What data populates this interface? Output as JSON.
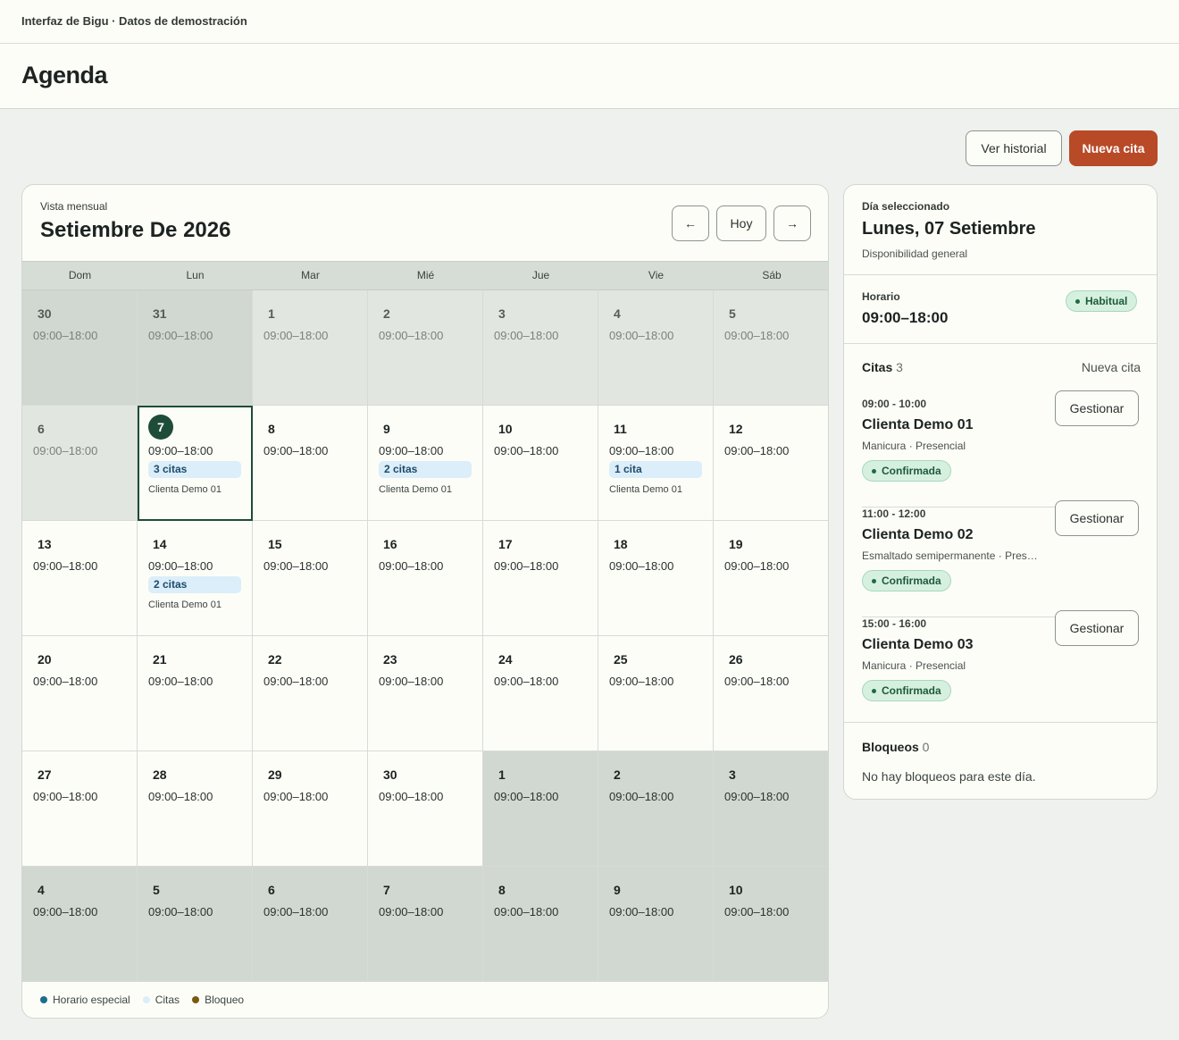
{
  "app": {
    "breadcrumb": "Interfaz de Bigu · Datos de demostración",
    "page_title": "Agenda"
  },
  "toolbar": {
    "history_label": "Ver historial",
    "new_label": "Nueva cita"
  },
  "calendar": {
    "view_label": "Vista mensual",
    "month_title": "Setiembre De 2026",
    "prev_label": "←",
    "today_label": "Hoy",
    "next_label": "→",
    "weekdays": [
      "Dom",
      "Lun",
      "Mar",
      "Mié",
      "Jue",
      "Vie",
      "Sáb"
    ],
    "weeks": [
      [
        {
          "day": "30",
          "hours": "09:00–18:00",
          "shade": "dark"
        },
        {
          "day": "31",
          "hours": "09:00–18:00",
          "shade": "dark"
        },
        {
          "day": "1",
          "hours": "09:00–18:00",
          "shade": "grey"
        },
        {
          "day": "2",
          "hours": "09:00–18:00",
          "shade": "grey"
        },
        {
          "day": "3",
          "hours": "09:00–18:00",
          "shade": "grey"
        },
        {
          "day": "4",
          "hours": "09:00–18:00",
          "shade": "grey"
        },
        {
          "day": "5",
          "hours": "09:00–18:00",
          "shade": "grey"
        }
      ],
      [
        {
          "day": "6",
          "hours": "09:00–18:00",
          "shade": "grey"
        },
        {
          "day": "7",
          "hours": "09:00–18:00",
          "selected": true,
          "badge": "3 citas",
          "client": "Clienta Demo 01"
        },
        {
          "day": "8",
          "hours": "09:00–18:00"
        },
        {
          "day": "9",
          "hours": "09:00–18:00",
          "badge": "2 citas",
          "client": "Clienta Demo 01"
        },
        {
          "day": "10",
          "hours": "09:00–18:00"
        },
        {
          "day": "11",
          "hours": "09:00–18:00",
          "badge": "1 cita",
          "client": "Clienta Demo 01"
        },
        {
          "day": "12",
          "hours": "09:00–18:00"
        }
      ],
      [
        {
          "day": "13",
          "hours": "09:00–18:00"
        },
        {
          "day": "14",
          "hours": "09:00–18:00",
          "badge": "2 citas",
          "client": "Clienta Demo 01"
        },
        {
          "day": "15",
          "hours": "09:00–18:00"
        },
        {
          "day": "16",
          "hours": "09:00–18:00"
        },
        {
          "day": "17",
          "hours": "09:00–18:00"
        },
        {
          "day": "18",
          "hours": "09:00–18:00"
        },
        {
          "day": "19",
          "hours": "09:00–18:00"
        }
      ],
      [
        {
          "day": "20",
          "hours": "09:00–18:00"
        },
        {
          "day": "21",
          "hours": "09:00–18:00"
        },
        {
          "day": "22",
          "hours": "09:00–18:00"
        },
        {
          "day": "23",
          "hours": "09:00–18:00"
        },
        {
          "day": "24",
          "hours": "09:00–18:00"
        },
        {
          "day": "25",
          "hours": "09:00–18:00"
        },
        {
          "day": "26",
          "hours": "09:00–18:00"
        }
      ],
      [
        {
          "day": "27",
          "hours": "09:00–18:00"
        },
        {
          "day": "28",
          "hours": "09:00–18:00"
        },
        {
          "day": "29",
          "hours": "09:00–18:00"
        },
        {
          "day": "30",
          "hours": "09:00–18:00"
        },
        {
          "day": "1",
          "hours": "09:00–18:00",
          "shade": "dark",
          "out": true
        },
        {
          "day": "2",
          "hours": "09:00–18:00",
          "shade": "dark",
          "out": true
        },
        {
          "day": "3",
          "hours": "09:00–18:00",
          "shade": "dark",
          "out": true
        }
      ],
      [
        {
          "day": "4",
          "hours": "09:00–18:00",
          "shade": "dark",
          "out": true
        },
        {
          "day": "5",
          "hours": "09:00–18:00",
          "shade": "dark",
          "out": true
        },
        {
          "day": "6",
          "hours": "09:00–18:00",
          "shade": "dark",
          "out": true
        },
        {
          "day": "7",
          "hours": "09:00–18:00",
          "shade": "dark",
          "out": true
        },
        {
          "day": "8",
          "hours": "09:00–18:00",
          "shade": "dark",
          "out": true
        },
        {
          "day": "9",
          "hours": "09:00–18:00",
          "shade": "dark",
          "out": true
        },
        {
          "day": "10",
          "hours": "09:00–18:00",
          "shade": "dark",
          "out": true
        }
      ]
    ],
    "legend": [
      {
        "label": "Horario especial",
        "color": "#1b6f8e"
      },
      {
        "label": "Citas",
        "color": "#dbeef9"
      },
      {
        "label": "Bloqueo",
        "color": "#7a5a10"
      }
    ]
  },
  "side": {
    "selected_label": "Día seleccionado",
    "selected_title": "Lunes, 07 Setiembre",
    "availability": "Disponibilidad general",
    "schedule_label": "Horario",
    "schedule_hours": "09:00–18:00",
    "schedule_pill": "Habitual",
    "appointments_label": "Citas",
    "appointments_count": "3",
    "new_appointment": "Nueva cita",
    "appointments": [
      {
        "time": "09:00 - 10:00",
        "name": "Clienta Demo 01",
        "service": "Manicura · Presencial",
        "status": "Confirmada",
        "action": "Gestionar"
      },
      {
        "time": "11:00 - 12:00",
        "name": "Clienta Demo 02",
        "service": "Esmaltado semipermanente · Presencial",
        "status": "Confirmada",
        "action": "Gestionar"
      },
      {
        "time": "15:00 - 16:00",
        "name": "Clienta Demo 03",
        "service": "Manicura · Presencial",
        "status": "Confirmada",
        "action": "Gestionar"
      }
    ],
    "blocks_label": "Bloqueos",
    "blocks_count": "0",
    "blocks_empty": "No hay bloqueos para este día."
  }
}
